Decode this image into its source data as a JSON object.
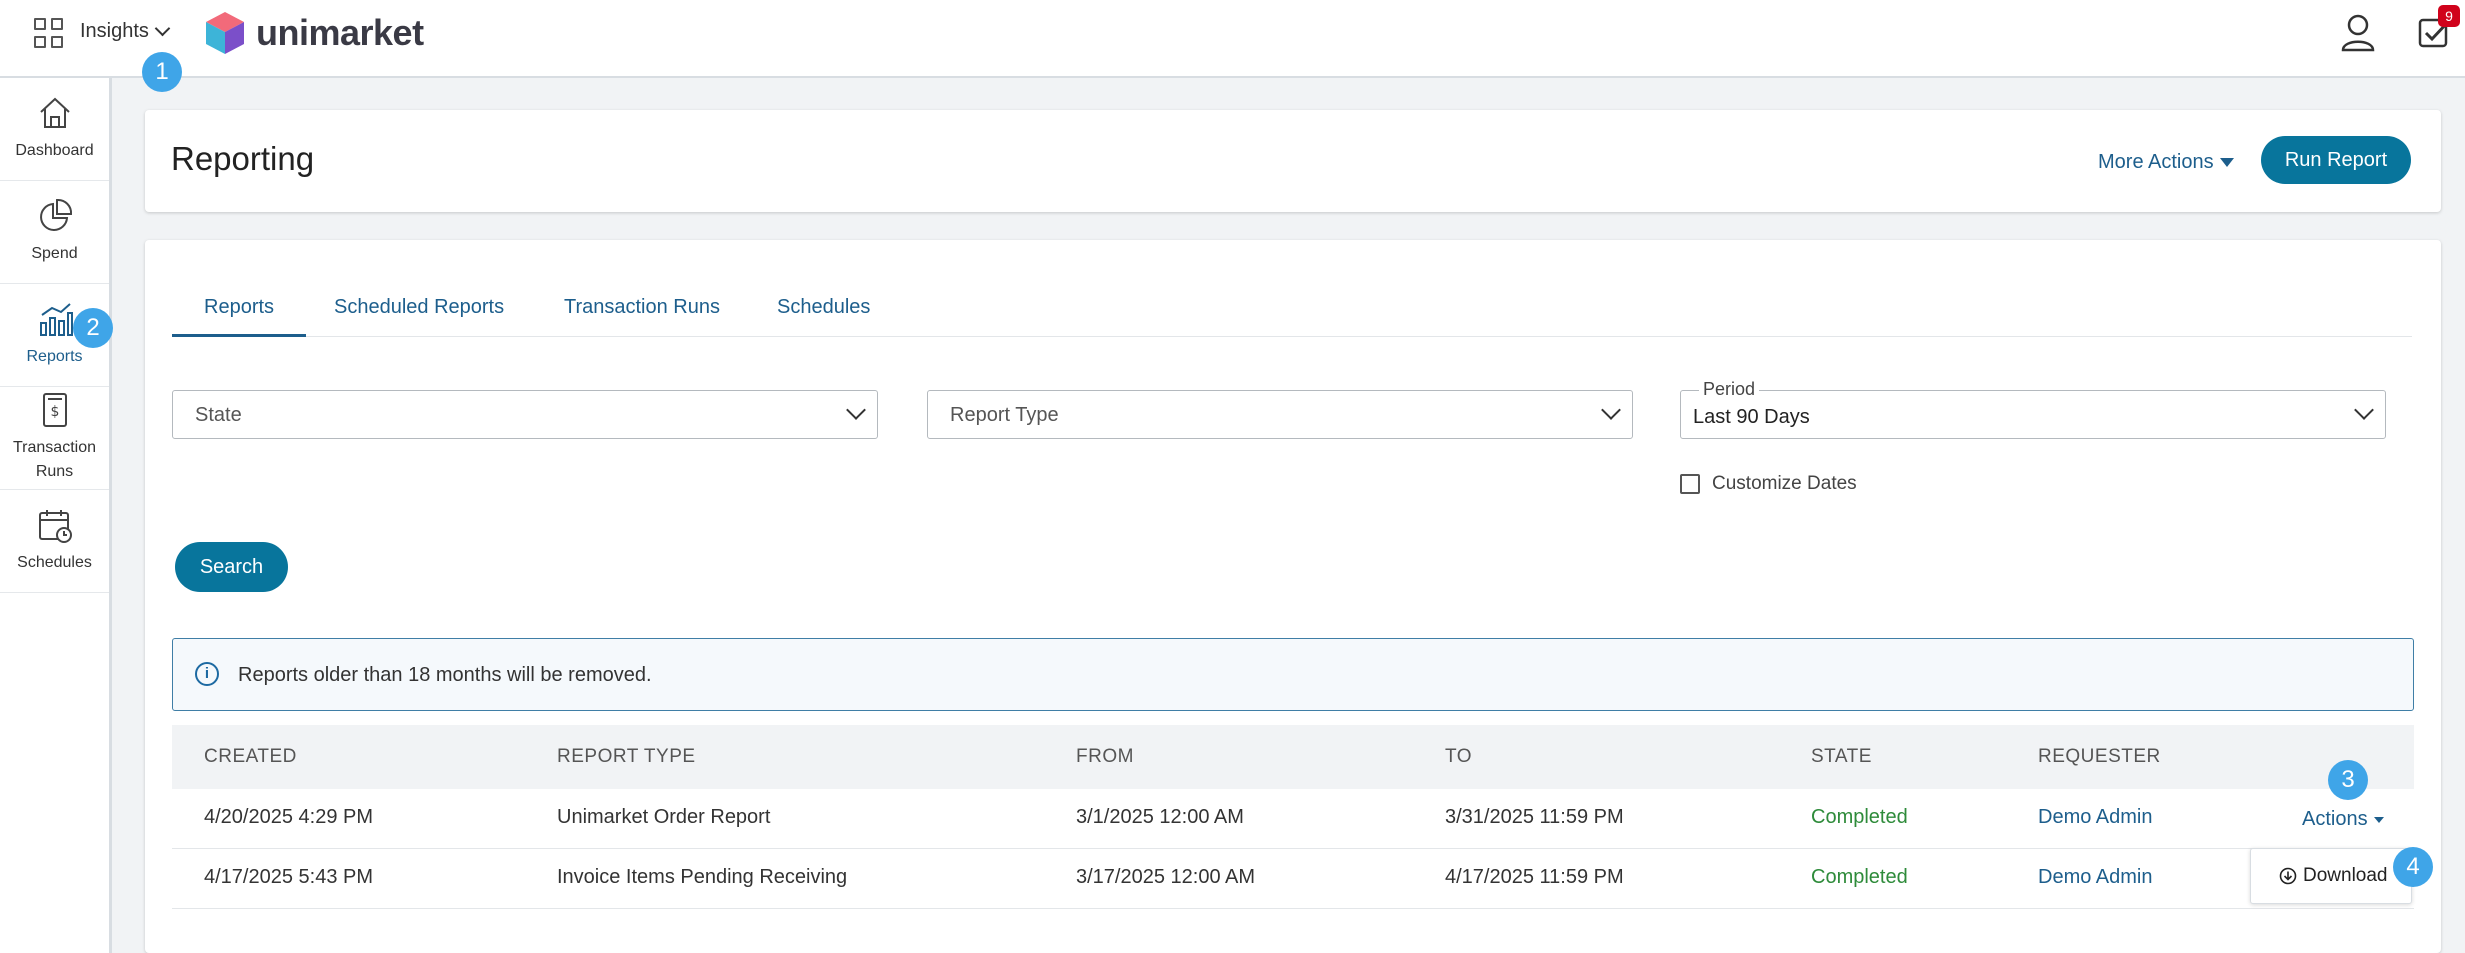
{
  "topbar": {
    "app_switch_label": "Insights",
    "logo_text": "unimarket",
    "tasks_badge": "9"
  },
  "markers": [
    "1",
    "2",
    "3",
    "4"
  ],
  "sidebar": {
    "items": [
      {
        "label": "Dashboard",
        "icon": "home-icon"
      },
      {
        "label": "Spend",
        "icon": "pie-chart-icon"
      },
      {
        "label": "Reports",
        "icon": "bar-chart-icon"
      },
      {
        "label": "Transaction Runs",
        "icon": "receipt-icon"
      },
      {
        "label": "Schedules",
        "icon": "calendar-clock-icon"
      }
    ]
  },
  "header": {
    "title": "Reporting",
    "more_actions": "More Actions",
    "run_report": "Run Report"
  },
  "tabs": [
    "Reports",
    "Scheduled Reports",
    "Transaction Runs",
    "Schedules"
  ],
  "filters": {
    "state_placeholder": "State",
    "report_type_placeholder": "Report Type",
    "period_label": "Period",
    "period_value": "Last 90 Days",
    "customize_dates": "Customize Dates"
  },
  "search_button": "Search",
  "info_message": "Reports older than 18 months will be removed.",
  "table": {
    "columns": [
      "CREATED",
      "REPORT TYPE",
      "FROM",
      "TO",
      "STATE",
      "REQUESTER"
    ],
    "rows": [
      {
        "created": "4/20/2025 4:29 PM",
        "report_type": "Unimarket Order Report",
        "from": "3/1/2025 12:00 AM",
        "to": "3/31/2025 11:59 PM",
        "state": "Completed",
        "requester": "Demo Admin"
      },
      {
        "created": "4/17/2025 5:43 PM",
        "report_type": "Invoice Items Pending Receiving",
        "from": "3/17/2025 12:00 AM",
        "to": "4/17/2025 11:59 PM",
        "state": "Completed",
        "requester": "Demo Admin"
      }
    ],
    "actions_label": "Actions",
    "download_label": "Download"
  },
  "colors": {
    "brand": "#08759c",
    "link": "#1d5e8c",
    "completed": "#2e8b3a",
    "marker": "#3fa5e8",
    "badge": "#d0021b"
  }
}
